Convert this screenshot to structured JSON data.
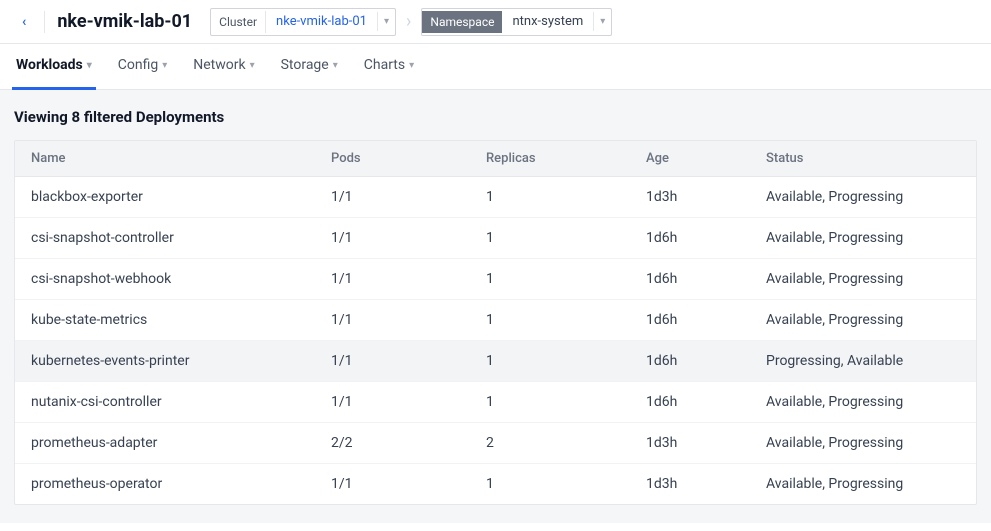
{
  "topbar": {
    "back": "‹",
    "title": "nke-vmik-lab-01",
    "cluster_tag": "Cluster",
    "cluster_value": "nke-vmik-lab-01",
    "arrow": "›",
    "namespace_tag": "Namespace",
    "namespace_value": "ntnx-system"
  },
  "subnav": {
    "tabs": [
      {
        "label": "Workloads",
        "active": true
      },
      {
        "label": "Config",
        "active": false
      },
      {
        "label": "Network",
        "active": false
      },
      {
        "label": "Storage",
        "active": false
      },
      {
        "label": "Charts",
        "active": false
      }
    ]
  },
  "viewing_text": "Viewing 8 filtered Deployments",
  "table": {
    "columns": [
      "Name",
      "Pods",
      "Replicas",
      "Age",
      "Status"
    ],
    "rows": [
      {
        "name": "blackbox-exporter",
        "pods": "1/1",
        "replicas": "1",
        "age": "1d3h",
        "status": "Available, Progressing",
        "highlighted": false
      },
      {
        "name": "csi-snapshot-controller",
        "pods": "1/1",
        "replicas": "1",
        "age": "1d6h",
        "status": "Available, Progressing",
        "highlighted": false
      },
      {
        "name": "csi-snapshot-webhook",
        "pods": "1/1",
        "replicas": "1",
        "age": "1d6h",
        "status": "Available, Progressing",
        "highlighted": false
      },
      {
        "name": "kube-state-metrics",
        "pods": "1/1",
        "replicas": "1",
        "age": "1d6h",
        "status": "Available, Progressing",
        "highlighted": false
      },
      {
        "name": "kubernetes-events-printer",
        "pods": "1/1",
        "replicas": "1",
        "age": "1d6h",
        "status": "Progressing, Available",
        "highlighted": true
      },
      {
        "name": "nutanix-csi-controller",
        "pods": "1/1",
        "replicas": "1",
        "age": "1d6h",
        "status": "Available, Progressing",
        "highlighted": false
      },
      {
        "name": "prometheus-adapter",
        "pods": "2/2",
        "replicas": "2",
        "age": "1d3h",
        "status": "Available, Progressing",
        "highlighted": false
      },
      {
        "name": "prometheus-operator",
        "pods": "1/1",
        "replicas": "1",
        "age": "1d3h",
        "status": "Available, Progressing",
        "highlighted": false
      }
    ]
  }
}
